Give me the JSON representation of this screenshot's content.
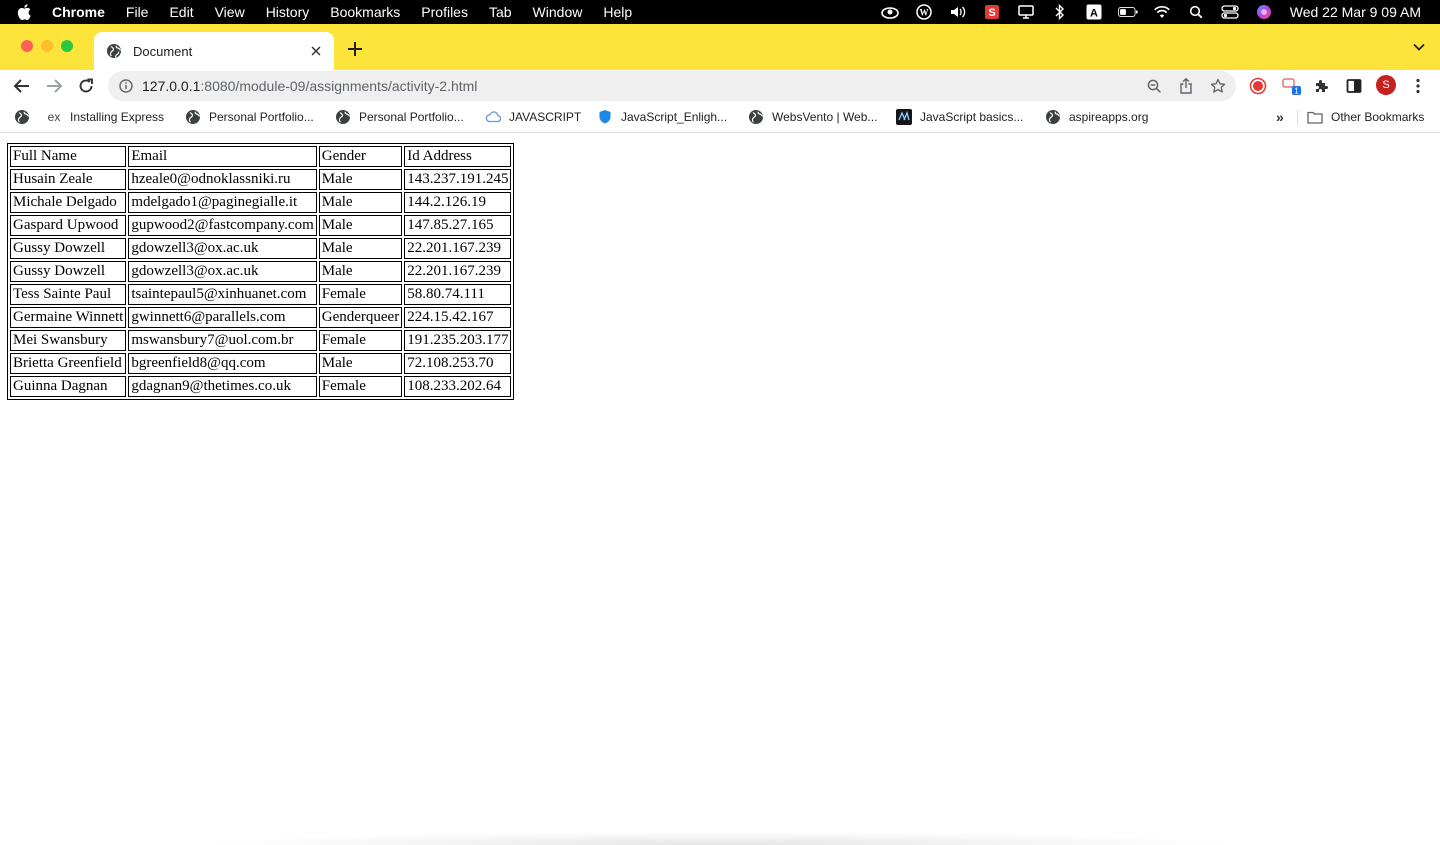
{
  "menubar": {
    "app_name": "Chrome",
    "items": [
      "File",
      "Edit",
      "View",
      "History",
      "Bookmarks",
      "Profiles",
      "Tab",
      "Window",
      "Help"
    ],
    "clock": "Wed 22 Mar  9 09 AM"
  },
  "tab": {
    "title": "Document"
  },
  "omnibox": {
    "host": "127.0.0.1",
    "path": ":8080/module-09/assignments/activity-2.html"
  },
  "profile_initial": "S",
  "extension_badge": "1",
  "bookmarks": {
    "items": [
      {
        "label": "Installing Express",
        "icon": "ex"
      },
      {
        "label": "Personal Portfolio...",
        "icon": "globe"
      },
      {
        "label": "Personal Portfolio...",
        "icon": "globe"
      },
      {
        "label": "JAVASCRIPT",
        "icon": "cloud"
      },
      {
        "label": "JavaScript_Enligh...",
        "icon": "shield"
      },
      {
        "label": "WebsVento | Web...",
        "icon": "globe"
      },
      {
        "label": "JavaScript basics...",
        "icon": "mdn"
      },
      {
        "label": "aspireapps.org",
        "icon": "globe"
      }
    ],
    "other": "Other Bookmarks"
  },
  "table": {
    "headers": [
      "Full Name",
      "Email",
      "Gender",
      "Id Address"
    ],
    "rows": [
      [
        "Husain Zeale",
        "hzeale0@odnoklassniki.ru",
        "Male",
        "143.237.191.245"
      ],
      [
        "Michale Delgado",
        "mdelgado1@paginegialle.it",
        "Male",
        "144.2.126.19"
      ],
      [
        "Gaspard Upwood",
        "gupwood2@fastcompany.com",
        "Male",
        "147.85.27.165"
      ],
      [
        "Gussy Dowzell",
        "gdowzell3@ox.ac.uk",
        "Male",
        "22.201.167.239"
      ],
      [
        "Gussy Dowzell",
        "gdowzell3@ox.ac.uk",
        "Male",
        "22.201.167.239"
      ],
      [
        "Tess Sainte Paul",
        "tsaintepaul5@xinhuanet.com",
        "Female",
        "58.80.74.111"
      ],
      [
        "Germaine Winnett",
        "gwinnett6@parallels.com",
        "Genderqueer",
        "224.15.42.167"
      ],
      [
        "Mei Swansbury",
        "mswansbury7@uol.com.br",
        "Female",
        "191.235.203.177"
      ],
      [
        "Brietta Greenfield",
        "bgreenfield8@qq.com",
        "Male",
        "72.108.253.70"
      ],
      [
        "Guinna Dagnan",
        "gdagnan9@thetimes.co.uk",
        "Female",
        "108.233.202.64"
      ]
    ]
  },
  "colors": {
    "tabstrip": "#fde43a",
    "menubar": "#000000",
    "profile": "#c5221f"
  }
}
